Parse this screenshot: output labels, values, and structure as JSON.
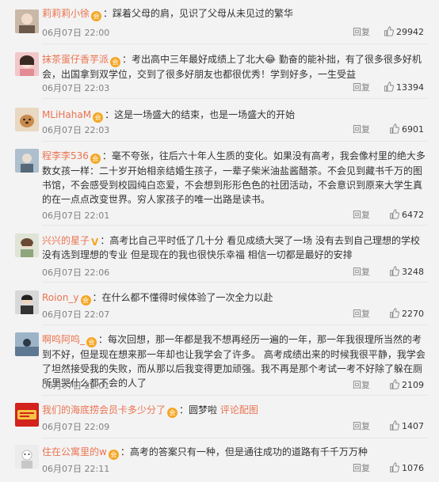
{
  "comments": [
    {
      "user": "莉莉莉小徐",
      "badge": "会",
      "text": "踩着父母的肩，见识了父母从未见过的繁华",
      "time": "06月07日 22:00",
      "reply": "回复",
      "likes": "29942"
    },
    {
      "user": "抹茶蛋仔香芋派",
      "badge": "会",
      "text": "考出高中三年最好成绩上了北大😂 勤奋的能补拙，有了很多很多好机会，出国拿到双学位，交到了很多好朋友也都很优秀！学到好多，一生受益",
      "time": "06月07日 22:03",
      "reply": "回复",
      "likes": "13394"
    },
    {
      "user": "MLiHahaM",
      "badge": "会",
      "text": "这是一场盛大的结束，也是一场盛大的开始",
      "time": "06月07日 22:03",
      "reply": "回复",
      "likes": "6901"
    },
    {
      "user": "程李李536",
      "badge": "会",
      "text": "毫不夸张，往后六十年人生质的变化。如果没有高考，我会像村里的绝大多数女孩一样：二十岁开始相亲结婚生孩子，一辈子柴米油盐酱醋茶。不会见到藏书千万的图书馆，不会感受到校园纯白恋爱，不会想到形形色色的社团活动，不会意识到原来大学生真的在一点点改变世界。穷人家孩子的唯一出路是读书。",
      "time": "06月07日 22:01",
      "reply": "回复",
      "likes": "6472"
    },
    {
      "user": "兴兴的星子",
      "badge": "V",
      "text": "高考比自己平时低了几十分 看见成绩大哭了一场 没有去到自己理想的学校 没有选到理想的专业 但是现在的我也很快乐幸福 相信一切都是最好的安排",
      "time": "06月07日 22:06",
      "reply": "回复",
      "likes": "3248"
    },
    {
      "user": "Roion_y",
      "badge": "会",
      "text": "在什么都不懂得时候体验了一次全力以赴",
      "time": "06月07日 22:07",
      "reply": "回复",
      "likes": "2270"
    },
    {
      "user": "啊呜阿呜_",
      "badge": "会",
      "text": "每次回想，那一年都是我不想再经历一遍的一年，那一年我很理所当然的考到不好，但是现在想来那一年却也让我学会了许多。 高考成绩出来的时候我很平静，我学会了坦然接受我的失败，而从那以后我变得更加顽强。我不再是那个考试一考不好除了躲在厕所里哭什么都不会的人了",
      "time": "06月07日 22:01",
      "reply": "回复",
      "likes": "2109"
    },
    {
      "user": "我们的海底捞会员卡多少分了",
      "badge": "会",
      "text": "圆梦啦",
      "link": "评论配图",
      "time": "06月07日 22:09",
      "reply": "回复",
      "likes": "1407"
    },
    {
      "user": "住在公寓里的w",
      "badge": "会",
      "text": "高考的答案只有一种，但是通往成功的道路有千千万万种",
      "time": "06月07日 22:11",
      "reply": "回复",
      "likes": "1076"
    }
  ]
}
